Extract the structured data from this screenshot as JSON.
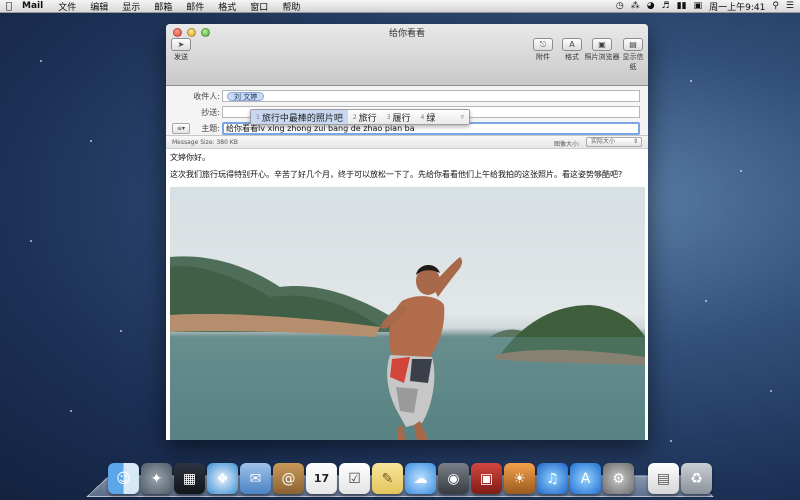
{
  "menubar": {
    "app": "Mail",
    "items": [
      "文件",
      "编辑",
      "显示",
      "邮箱",
      "邮件",
      "格式",
      "窗口",
      "帮助"
    ],
    "clock": "周一上午9:41"
  },
  "window": {
    "title": "给你看看",
    "toolbar": {
      "send": "发送",
      "attach": "附件",
      "format": "格式",
      "photo_browser": "照片浏览器",
      "show_stationery": "显示信纸"
    }
  },
  "header": {
    "to_label": "收件人:",
    "to_chip": "刘 文婷",
    "cc_label": "抄送:",
    "subject_label": "主题:",
    "subject_value": "给你看看lv xing zhong zui bang de zhao pian ba"
  },
  "ime": {
    "candidates": [
      {
        "num": "1",
        "text": "旅行中最棒的照片吧"
      },
      {
        "num": "2",
        "text": "旅行"
      },
      {
        "num": "3",
        "text": "履行"
      },
      {
        "num": "4",
        "text": "绿"
      }
    ]
  },
  "status": {
    "message_size": "Message Size:  380 KB",
    "image_size_label": "图像大小:",
    "image_size_value": "实际大小"
  },
  "body": {
    "greeting": "文婷你好。",
    "paragraph": "这次我们旅行玩得特别开心。辛苦了好几个月，终于可以放松一下了。先给你看看他们上午给我拍的这张照片。看这姿势够酷吧?"
  },
  "dock": {
    "icons": [
      "finder-icon",
      "launchpad-icon",
      "mission-control-icon",
      "safari-icon",
      "mail-icon",
      "contacts-icon",
      "calendar-icon",
      "reminders-icon",
      "notes-icon",
      "messages-icon",
      "facetime-icon",
      "photo-booth-icon",
      "iphoto-icon",
      "itunes-icon",
      "app-store-icon",
      "system-preferences-icon",
      "downloads-icon",
      "trash-icon"
    ],
    "calendar_day": "17"
  }
}
